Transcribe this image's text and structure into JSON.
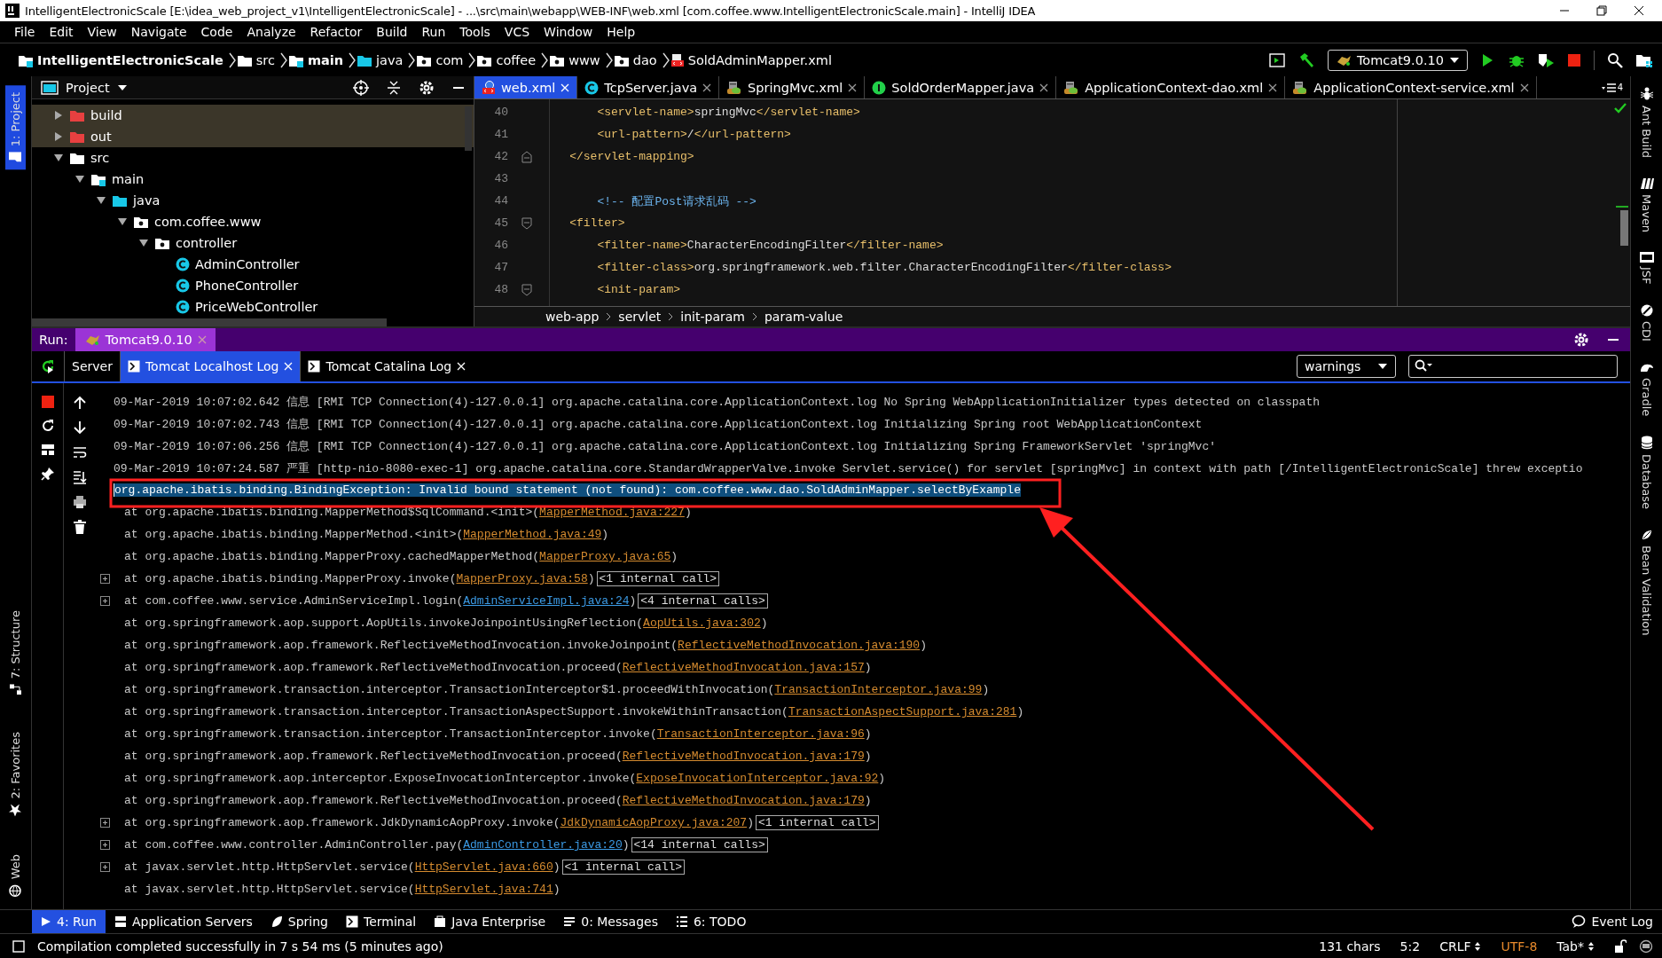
{
  "window": {
    "title": "IntelligentElectronicScale [E:\\idea_web_project_v1\\IntelligentElectronicScale] - ...\\src\\main\\webapp\\WEB-INF\\web.xml [com.coffee.www.IntelligentElectronicScale.main] - IntelliJ IDEA"
  },
  "menu": [
    "File",
    "Edit",
    "View",
    "Navigate",
    "Code",
    "Analyze",
    "Refactor",
    "Build",
    "Run",
    "Tools",
    "VCS",
    "Window",
    "Help"
  ],
  "breadcrumbs": [
    {
      "text": "IntelligentElectronicScale",
      "kind": "module"
    },
    {
      "text": "src",
      "kind": "folder"
    },
    {
      "text": "main",
      "kind": "source-root"
    },
    {
      "text": "java",
      "kind": "source-folder"
    },
    {
      "text": "com",
      "kind": "package"
    },
    {
      "text": "coffee",
      "kind": "package"
    },
    {
      "text": "www",
      "kind": "package"
    },
    {
      "text": "dao",
      "kind": "package"
    },
    {
      "text": "SoldAdminMapper.xml",
      "kind": "xml"
    }
  ],
  "run_configuration": "Tomcat9.0.10",
  "left_strip": {
    "top": [
      {
        "label": "1: Project",
        "selected": true
      }
    ],
    "bottom": [
      {
        "label": "7: Structure",
        "selected": false
      },
      {
        "label": "2: Favorites",
        "selected": false
      },
      {
        "label": "Web",
        "selected": false
      }
    ]
  },
  "right_strip": [
    {
      "label": "Ant Build",
      "selected": false
    },
    {
      "label": "Maven",
      "selected": false
    },
    {
      "label": "JSF",
      "selected": false
    },
    {
      "label": "CDI",
      "selected": false
    },
    {
      "label": "Gradle",
      "selected": false
    },
    {
      "label": "Database",
      "selected": false
    },
    {
      "label": "Bean Validation",
      "selected": false
    }
  ],
  "project": {
    "title": "Project",
    "tree": [
      {
        "label": "build",
        "kind": "excluded-folder",
        "excluded": true,
        "expanded": false
      },
      {
        "label": "out",
        "kind": "excluded-folder",
        "excluded": true,
        "expanded": false
      },
      {
        "label": "src",
        "kind": "folder",
        "excluded": false,
        "expanded": true,
        "children": [
          {
            "label": "main",
            "kind": "source-root",
            "excluded": false,
            "expanded": true,
            "children": [
              {
                "label": "java",
                "kind": "source-folder",
                "excluded": false,
                "expanded": true,
                "children": [
                  {
                    "label": "com.coffee.www",
                    "kind": "package",
                    "excluded": false,
                    "expanded": true,
                    "children": [
                      {
                        "label": "controller",
                        "kind": "package",
                        "excluded": false,
                        "expanded": true,
                        "children": [
                          {
                            "label": "AdminController",
                            "kind": "class",
                            "excluded": false
                          },
                          {
                            "label": "PhoneController",
                            "kind": "class",
                            "excluded": false
                          },
                          {
                            "label": "PriceWebController",
                            "kind": "class",
                            "excluded": false
                          }
                        ]
                      }
                    ]
                  }
                ]
              }
            ]
          }
        ]
      }
    ]
  },
  "editor_tabs": [
    {
      "label": "web.xml",
      "kind": "web-xml",
      "selected": true
    },
    {
      "label": "TcpServer.java",
      "kind": "class",
      "selected": false
    },
    {
      "label": "SpringMvc.xml",
      "kind": "spring-xml",
      "selected": false
    },
    {
      "label": "SoldOrderMapper.java",
      "kind": "interface",
      "selected": false
    },
    {
      "label": "ApplicationContext-dao.xml",
      "kind": "spring-xml",
      "selected": false
    },
    {
      "label": "ApplicationContext-service.xml",
      "kind": "spring-xml",
      "selected": false
    }
  ],
  "tab_overflow_count": "4",
  "code": [
    {
      "number": "40",
      "fold_start": false,
      "fold_end": false,
      "segments": [
        {
          "kind": "tag",
          "text": "        <servlet-name>"
        },
        {
          "kind": "text",
          "text": "springMvc"
        },
        {
          "kind": "tag",
          "text": "</servlet-name>"
        }
      ]
    },
    {
      "number": "41",
      "fold_start": false,
      "fold_end": false,
      "segments": [
        {
          "kind": "tag",
          "text": "        <url-pattern>"
        },
        {
          "kind": "text",
          "text": "/"
        },
        {
          "kind": "tag",
          "text": "</url-pattern>"
        }
      ]
    },
    {
      "number": "42",
      "fold_start": false,
      "fold_end": true,
      "segments": [
        {
          "kind": "tag",
          "text": "    </servlet-mapping>"
        }
      ]
    },
    {
      "number": "43",
      "fold_start": false,
      "fold_end": false
    },
    {
      "number": "44",
      "fold_start": false,
      "fold_end": false,
      "segments": [
        {
          "kind": "comment",
          "text": "        <!-- 配置Post请求乱码 -->"
        }
      ]
    },
    {
      "number": "45",
      "fold_start": true,
      "fold_end": false,
      "segments": [
        {
          "kind": "tag",
          "text": "    <filter>"
        }
      ]
    },
    {
      "number": "46",
      "fold_start": false,
      "fold_end": false,
      "segments": [
        {
          "kind": "tag",
          "text": "        <filter-name>"
        },
        {
          "kind": "text",
          "text": "CharacterEncodingFilter"
        },
        {
          "kind": "tag",
          "text": "</filter-name>"
        }
      ]
    },
    {
      "number": "47",
      "fold_start": false,
      "fold_end": false,
      "segments": [
        {
          "kind": "tag",
          "text": "        <filter-class>"
        },
        {
          "kind": "text",
          "text": "org.springframework.web.filter.CharacterEncodingFilter"
        },
        {
          "kind": "tag",
          "text": "</filter-class>"
        }
      ]
    },
    {
      "number": "48",
      "fold_start": true,
      "fold_end": false,
      "segments": [
        {
          "kind": "tag",
          "text": "        <init-param>"
        }
      ]
    }
  ],
  "xml_path": [
    "web-app",
    "servlet",
    "init-param",
    "param-value"
  ],
  "run": {
    "label": "Run:",
    "tab": "Tomcat9.0.10",
    "tabs": [
      {
        "label": "Server",
        "kind": "plain",
        "selected": false
      },
      {
        "label": "Tomcat Localhost Log",
        "kind": "log",
        "selected": true
      },
      {
        "label": "Tomcat Catalina Log",
        "kind": "log",
        "selected": false
      }
    ],
    "filter": "warnings"
  },
  "log": [
    {
      "kind": "message",
      "selected": false,
      "text": "09-Mar-2019 10:07:02.642 信息 [RMI TCP Connection(4)-127.0.0.1] org.apache.catalina.core.ApplicationContext.log No Spring WebApplicationInitializer types detected on classpath"
    },
    {
      "kind": "message",
      "selected": false,
      "text": "09-Mar-2019 10:07:02.743 信息 [RMI TCP Connection(4)-127.0.0.1] org.apache.catalina.core.ApplicationContext.log Initializing Spring root WebApplicationContext"
    },
    {
      "kind": "message",
      "selected": false,
      "text": "09-Mar-2019 10:07:06.256 信息 [RMI TCP Connection(4)-127.0.0.1] org.apache.catalina.core.ApplicationContext.log Initializing Spring FrameworkServlet 'springMvc'"
    },
    {
      "kind": "message",
      "selected": false,
      "text": "09-Mar-2019 10:07:24.587 严重 [http-nio-8080-exec-1] org.apache.catalina.core.StandardWrapperValve.invoke Servlet.service() for servlet [springMvc] in context with path [/IntelligentElectronicScale] threw exceptio"
    },
    {
      "kind": "exception",
      "selected": true,
      "text": "org.apache.ibatis.binding.BindingException: Invalid bound statement (not found): com.coffee.www.dao.SoldAdminMapper.selectByExample"
    },
    {
      "kind": "frame",
      "selected": false,
      "expandable": false,
      "text": "at org.apache.ibatis.binding.MapperMethod$SqlCommand.<init>(",
      "link": {
        "text": "MapperMethod.java:227",
        "kind": "library"
      },
      "close": ")"
    },
    {
      "kind": "frame",
      "selected": false,
      "expandable": false,
      "text": "at org.apache.ibatis.binding.MapperMethod.<init>(",
      "link": {
        "text": "MapperMethod.java:49",
        "kind": "library"
      },
      "close": ")"
    },
    {
      "kind": "frame",
      "selected": false,
      "expandable": false,
      "text": "at org.apache.ibatis.binding.MapperProxy.cachedMapperMethod(",
      "link": {
        "text": "MapperProxy.java:65",
        "kind": "library"
      },
      "close": ")"
    },
    {
      "kind": "frame",
      "selected": false,
      "expandable": true,
      "text": "at org.apache.ibatis.binding.MapperProxy.invoke(",
      "link": {
        "text": "MapperProxy.java:58",
        "kind": "library"
      },
      "close": ")",
      "folded": "<1 internal call>"
    },
    {
      "kind": "frame",
      "selected": false,
      "expandable": true,
      "text": "at com.coffee.www.service.AdminServiceImpl.login(",
      "link": {
        "text": "AdminServiceImpl.java:24",
        "kind": "project"
      },
      "close": ")",
      "folded": "<4 internal calls>"
    },
    {
      "kind": "frame",
      "selected": false,
      "expandable": false,
      "text": "at org.springframework.aop.support.AopUtils.invokeJoinpointUsingReflection(",
      "link": {
        "text": "AopUtils.java:302",
        "kind": "library"
      },
      "close": ")"
    },
    {
      "kind": "frame",
      "selected": false,
      "expandable": false,
      "text": "at org.springframework.aop.framework.ReflectiveMethodInvocation.invokeJoinpoint(",
      "link": {
        "text": "ReflectiveMethodInvocation.java:190",
        "kind": "library"
      },
      "close": ")"
    },
    {
      "kind": "frame",
      "selected": false,
      "expandable": false,
      "text": "at org.springframework.aop.framework.ReflectiveMethodInvocation.proceed(",
      "link": {
        "text": "ReflectiveMethodInvocation.java:157",
        "kind": "library"
      },
      "close": ")"
    },
    {
      "kind": "frame",
      "selected": false,
      "expandable": false,
      "text": "at org.springframework.transaction.interceptor.TransactionInterceptor$1.proceedWithInvocation(",
      "link": {
        "text": "TransactionInterceptor.java:99",
        "kind": "library"
      },
      "close": ")"
    },
    {
      "kind": "frame",
      "selected": false,
      "expandable": false,
      "text": "at org.springframework.transaction.interceptor.TransactionAspectSupport.invokeWithinTransaction(",
      "link": {
        "text": "TransactionAspectSupport.java:281",
        "kind": "library"
      },
      "close": ")"
    },
    {
      "kind": "frame",
      "selected": false,
      "expandable": false,
      "text": "at org.springframework.transaction.interceptor.TransactionInterceptor.invoke(",
      "link": {
        "text": "TransactionInterceptor.java:96",
        "kind": "library"
      },
      "close": ")"
    },
    {
      "kind": "frame",
      "selected": false,
      "expandable": false,
      "text": "at org.springframework.aop.framework.ReflectiveMethodInvocation.proceed(",
      "link": {
        "text": "ReflectiveMethodInvocation.java:179",
        "kind": "library"
      },
      "close": ")"
    },
    {
      "kind": "frame",
      "selected": false,
      "expandable": false,
      "text": "at org.springframework.aop.interceptor.ExposeInvocationInterceptor.invoke(",
      "link": {
        "text": "ExposeInvocationInterceptor.java:92",
        "kind": "library"
      },
      "close": ")"
    },
    {
      "kind": "frame",
      "selected": false,
      "expandable": false,
      "text": "at org.springframework.aop.framework.ReflectiveMethodInvocation.proceed(",
      "link": {
        "text": "ReflectiveMethodInvocation.java:179",
        "kind": "library"
      },
      "close": ")"
    },
    {
      "kind": "frame",
      "selected": false,
      "expandable": true,
      "text": "at org.springframework.aop.framework.JdkDynamicAopProxy.invoke(",
      "link": {
        "text": "JdkDynamicAopProxy.java:207",
        "kind": "library"
      },
      "close": ")",
      "folded": "<1 internal call>"
    },
    {
      "kind": "frame",
      "selected": false,
      "expandable": true,
      "text": "at com.coffee.www.controller.AdminController.pay(",
      "link": {
        "text": "AdminController.java:20",
        "kind": "project"
      },
      "close": ")",
      "folded": "<14 internal calls>"
    },
    {
      "kind": "frame",
      "selected": false,
      "expandable": true,
      "text": "at javax.servlet.http.HttpServlet.service(",
      "link": {
        "text": "HttpServlet.java:660",
        "kind": "library"
      },
      "close": ")",
      "folded": "<1 internal call>"
    },
    {
      "kind": "frame",
      "selected": false,
      "expandable": false,
      "text": "at javax.servlet.http.HttpServlet.service(",
      "link": {
        "text": "HttpServlet.java:741",
        "kind": "library"
      },
      "close": ")"
    }
  ],
  "tool_windows": [
    {
      "label": "4: Run",
      "selected": true
    },
    {
      "label": "Application Servers",
      "selected": false
    },
    {
      "label": "Spring",
      "selected": false
    },
    {
      "label": "Terminal",
      "selected": false
    },
    {
      "label": "Java Enterprise",
      "selected": false
    },
    {
      "label": "0: Messages",
      "selected": false
    },
    {
      "label": "6: TODO",
      "selected": false
    }
  ],
  "event_log": "Event Log",
  "status_bar": {
    "message": "Compilation completed successfully in 7 s 54 ms (5 minutes ago)",
    "items": [
      {
        "text": "131 chars",
        "kind": "plain"
      },
      {
        "text": "5:2",
        "kind": "plain"
      },
      {
        "text": "CRLF",
        "kind": "switch"
      },
      {
        "text": "UTF-8",
        "kind": "highlight"
      },
      {
        "text": "Tab*",
        "kind": "switch"
      }
    ]
  }
}
